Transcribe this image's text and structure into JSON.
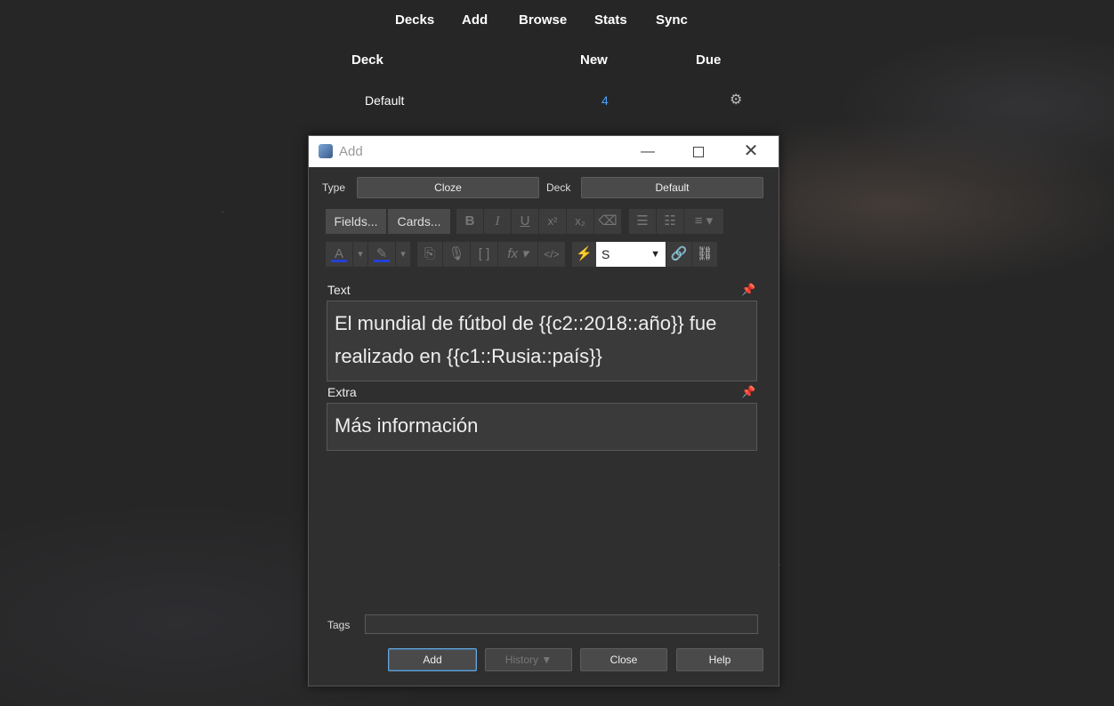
{
  "nav": {
    "items": [
      "Decks",
      "Add",
      "Browse",
      "Stats",
      "Sync"
    ]
  },
  "deck_list": {
    "headers": {
      "deck": "Deck",
      "new": "New",
      "due": "Due"
    },
    "rows": [
      {
        "name": "Default",
        "new": "4",
        "due": ""
      }
    ]
  },
  "dialog": {
    "title": "Add",
    "type_label": "Type",
    "type_value": "Cloze",
    "deck_label": "Deck",
    "deck_value": "Default",
    "toolbar": {
      "fields_button": "Fields...",
      "cards_button": "Cards...",
      "font_size_value": "S"
    },
    "fields": [
      {
        "label": "Text",
        "value": "El mundial de fútbol de {{c2::2018::año}} fue realizado en {{c1::Rusia::país}}"
      },
      {
        "label": "Extra",
        "value": "Más información"
      }
    ],
    "tags_label": "Tags",
    "tags_value": "",
    "buttons": {
      "add": "Add",
      "history": "History ▼",
      "close": "Close",
      "help": "Help"
    }
  }
}
